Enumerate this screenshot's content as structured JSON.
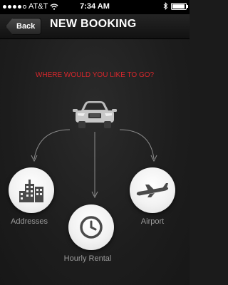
{
  "status_bar": {
    "carrier": "AT&T",
    "time": "7:34 AM",
    "battery_level": 0.95,
    "icons": [
      "signal-icon",
      "wifi-icon",
      "bluetooth-icon",
      "battery-icon"
    ]
  },
  "nav": {
    "back_label": "Back",
    "title": "NEW BOOKING"
  },
  "prompt": "WHERE WOULD YOU LIKE TO GO?",
  "options": [
    {
      "label": "Addresses",
      "icon": "buildings-icon"
    },
    {
      "label": "Airport",
      "icon": "airplane-icon"
    },
    {
      "label": "Hourly Rental",
      "icon": "clock-icon"
    }
  ],
  "colors": {
    "accent": "#d6272c",
    "background": "#1b1b1b",
    "label": "#9a9a9a"
  }
}
